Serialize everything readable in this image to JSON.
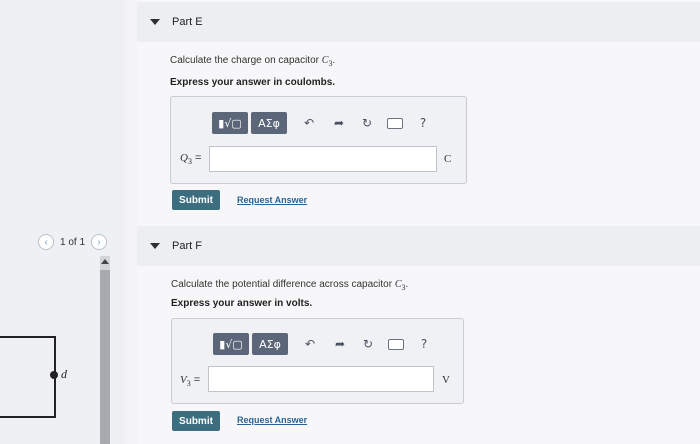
{
  "navigation": {
    "pager_text": "1 of 1",
    "prev_icon": "chevron-left-icon",
    "next_icon": "chevron-right-icon"
  },
  "figure": {
    "node_label": "d"
  },
  "parts": {
    "e": {
      "header": "Part E",
      "question_text": "Calculate the charge on capacitor ",
      "question_var": "C",
      "question_var_sub": "3",
      "question_end": ".",
      "instruction": "Express your answer in coulombs.",
      "answer_var": "Q",
      "answer_var_sub": "3",
      "answer_eq": " =",
      "answer_value": "",
      "unit": "C",
      "submit_label": "Submit",
      "request_label": "Request Answer"
    },
    "f": {
      "header": "Part F",
      "question_text": "Calculate the potential difference across capacitor ",
      "question_var": "C",
      "question_var_sub": "3",
      "question_end": ".",
      "instruction": "Express your answer in volts.",
      "answer_var": "V",
      "answer_var_sub": "3",
      "answer_eq": " =",
      "answer_value": "",
      "unit": "V",
      "submit_label": "Submit",
      "request_label": "Request Answer"
    }
  },
  "toolbar": {
    "template_label": "▮√▢",
    "greek_label": "ΑΣφ",
    "undo_glyph": "↶",
    "redo_glyph": "➦",
    "reset_glyph": "↻",
    "help_glyph": "?"
  }
}
